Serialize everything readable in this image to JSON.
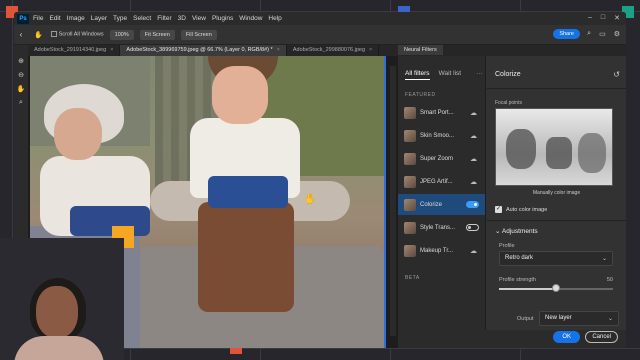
{
  "menu": {
    "logo": "Ps",
    "items": [
      "File",
      "Edit",
      "Image",
      "Layer",
      "Type",
      "Select",
      "Filter",
      "3D",
      "View",
      "Plugins",
      "Window",
      "Help"
    ]
  },
  "options_bar": {
    "scroll_all": "Scroll All Windows",
    "zoom_btn": "100%",
    "fit_btn": "Fit Screen",
    "fill_btn": "Fill Screen",
    "share": "Share"
  },
  "tabs": [
    {
      "label": "AdobeStock_291914340.jpeg"
    },
    {
      "label": "AdobeStock_389969759.jpeg @ 66.7% (Layer 0, RGB/8#) *"
    },
    {
      "label": "AdobeStock_299880076.jpeg"
    }
  ],
  "neural_filters": {
    "panel_title": "Neural Filters",
    "tab_all": "All filters",
    "tab_wait": "Wait list",
    "featured_label": "FEATURED",
    "beta_label": "BETA",
    "filters": [
      {
        "label": "Smart Port...",
        "state": "cloud"
      },
      {
        "label": "Skin Smoo...",
        "state": "cloud"
      },
      {
        "label": "Super Zoom",
        "state": "cloud"
      },
      {
        "label": "JPEG Artif...",
        "state": "cloud"
      },
      {
        "label": "Colorize",
        "state": "on"
      },
      {
        "label": "Style Trans...",
        "state": "off"
      },
      {
        "label": "Makeup Tr...",
        "state": "cloud"
      }
    ]
  },
  "colorize": {
    "title": "Colorize",
    "focal_points": "Focal points",
    "caption": "Manually color image",
    "auto_color": "Auto color image",
    "adjustments": "Adjustments",
    "profile_label": "Profile",
    "profile_value": "Retro dark",
    "strength_label": "Profile strength",
    "strength_value": "50",
    "strength_fraction": 0.5,
    "output_label": "Output",
    "output_value": "New layer",
    "ok": "OK",
    "cancel": "Cancel"
  }
}
